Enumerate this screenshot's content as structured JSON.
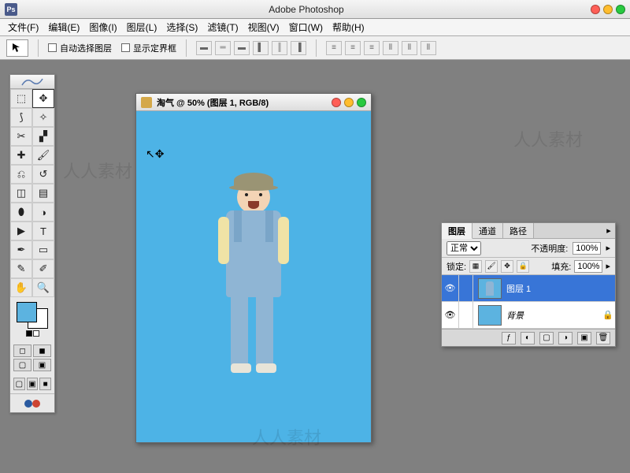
{
  "app": {
    "title": "Adobe Photoshop"
  },
  "menu": {
    "file": "文件(F)",
    "edit": "编辑(E)",
    "image": "图像(I)",
    "layer": "图层(L)",
    "select": "选择(S)",
    "filter": "滤镜(T)",
    "view": "视图(V)",
    "window": "窗口(W)",
    "help": "帮助(H)"
  },
  "options": {
    "auto_select_layer": "自动选择图层",
    "show_bounding_box": "显示定界框"
  },
  "document": {
    "title": "淘气 @ 50% (图层 1, RGB/8)"
  },
  "panel": {
    "tabs": {
      "layers": "图层",
      "channels": "通道",
      "paths": "路径"
    },
    "blend_mode": "正常",
    "opacity_label": "不透明度:",
    "opacity_value": "100%",
    "lock_label": "锁定:",
    "fill_label": "填充:",
    "fill_value": "100%",
    "layers": [
      {
        "name": "图层 1",
        "visible": true,
        "selected": true,
        "locked": false,
        "bg": false
      },
      {
        "name": "背景",
        "visible": true,
        "selected": false,
        "locked": true,
        "bg": true
      }
    ]
  },
  "colors": {
    "foreground": "#5cb3e0",
    "background": "#ffffff",
    "canvas": "#4db3e6"
  },
  "watermark": "人人素材"
}
